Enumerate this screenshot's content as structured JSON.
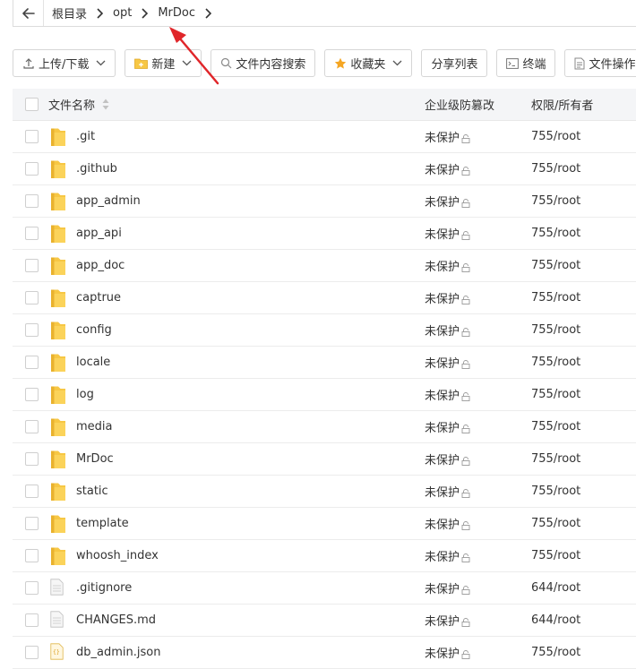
{
  "breadcrumb": {
    "items": [
      "根目录",
      "opt",
      "MrDoc"
    ]
  },
  "toolbar": {
    "upload_label": "上传/下载",
    "new_label": "新建",
    "search_label": "文件内容搜索",
    "favorites_label": "收藏夹",
    "share_label": "分享列表",
    "terminal_label": "终端",
    "fileops_label": "文件操作"
  },
  "table": {
    "headers": {
      "name": "文件名称",
      "protect": "企业级防篡改",
      "perm": "权限/所有者"
    },
    "rows": [
      {
        "name": ".git",
        "type": "folder",
        "protect": "未保护",
        "perm": "755/root"
      },
      {
        "name": ".github",
        "type": "folder",
        "protect": "未保护",
        "perm": "755/root"
      },
      {
        "name": "app_admin",
        "type": "folder",
        "protect": "未保护",
        "perm": "755/root"
      },
      {
        "name": "app_api",
        "type": "folder",
        "protect": "未保护",
        "perm": "755/root"
      },
      {
        "name": "app_doc",
        "type": "folder",
        "protect": "未保护",
        "perm": "755/root"
      },
      {
        "name": "captrue",
        "type": "folder",
        "protect": "未保护",
        "perm": "755/root"
      },
      {
        "name": "config",
        "type": "folder",
        "protect": "未保护",
        "perm": "755/root"
      },
      {
        "name": "locale",
        "type": "folder",
        "protect": "未保护",
        "perm": "755/root"
      },
      {
        "name": "log",
        "type": "folder",
        "protect": "未保护",
        "perm": "755/root"
      },
      {
        "name": "media",
        "type": "folder",
        "protect": "未保护",
        "perm": "755/root"
      },
      {
        "name": "MrDoc",
        "type": "folder",
        "protect": "未保护",
        "perm": "755/root"
      },
      {
        "name": "static",
        "type": "folder",
        "protect": "未保护",
        "perm": "755/root"
      },
      {
        "name": "template",
        "type": "folder",
        "protect": "未保护",
        "perm": "755/root"
      },
      {
        "name": "whoosh_index",
        "type": "folder",
        "protect": "未保护",
        "perm": "755/root"
      },
      {
        "name": ".gitignore",
        "type": "file",
        "protect": "未保护",
        "perm": "644/root"
      },
      {
        "name": "CHANGES.md",
        "type": "file",
        "protect": "未保护",
        "perm": "644/root"
      },
      {
        "name": "db_admin.json",
        "type": "json",
        "protect": "未保护",
        "perm": "755/root"
      }
    ]
  },
  "colors": {
    "folder": "#f7c744",
    "folder_dark": "#e9b22e",
    "annotation_arrow": "#e0262a",
    "header_bg": "#f4f5f7"
  }
}
